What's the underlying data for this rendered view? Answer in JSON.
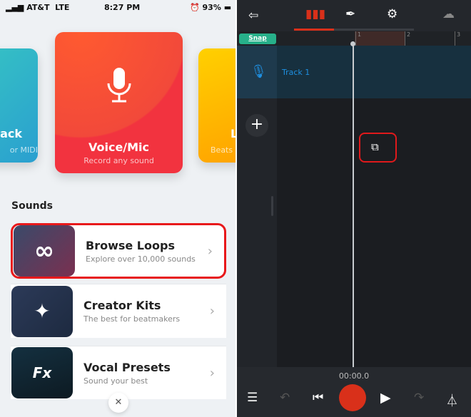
{
  "status_bar": {
    "carrier": "AT&T",
    "network": "LTE",
    "time": "8:27 PM",
    "battery": "93%"
  },
  "cards": [
    {
      "title": "Track",
      "subtitle": "Instrument or MIDI",
      "visible_title": "rack",
      "visible_subtitle": "or MIDI",
      "color": "#2fb3c9"
    },
    {
      "title": "Voice/Mic",
      "subtitle": "Record any sound",
      "color": "#f23a45",
      "icon": "microphone-icon"
    },
    {
      "title": "L",
      "subtitle": "Beats a",
      "color": "#ffb000"
    }
  ],
  "sounds": {
    "header": "Sounds",
    "items": [
      {
        "title": "Browse Loops",
        "subtitle": "Explore over 10,000 sounds",
        "thumb_label": "∞"
      },
      {
        "title": "Creator Kits",
        "subtitle": "The best for beatmakers",
        "thumb_label": "✦"
      },
      {
        "title": "Vocal Presets",
        "subtitle": "Sound your best",
        "thumb_label": "Fx"
      }
    ]
  },
  "close_label": "✕",
  "studio": {
    "tabs": [
      "exit-icon",
      "waveform-icon",
      "feather-icon",
      "gear-icon",
      "cloud-upload-icon"
    ],
    "snap_label": "Snap",
    "ruler": [
      "1",
      "2",
      "3"
    ],
    "track_name": "Track 1",
    "add_track_label": "+",
    "time": "00:00.0",
    "accent": "#d9301a",
    "track_color": "#1e8fe0"
  }
}
